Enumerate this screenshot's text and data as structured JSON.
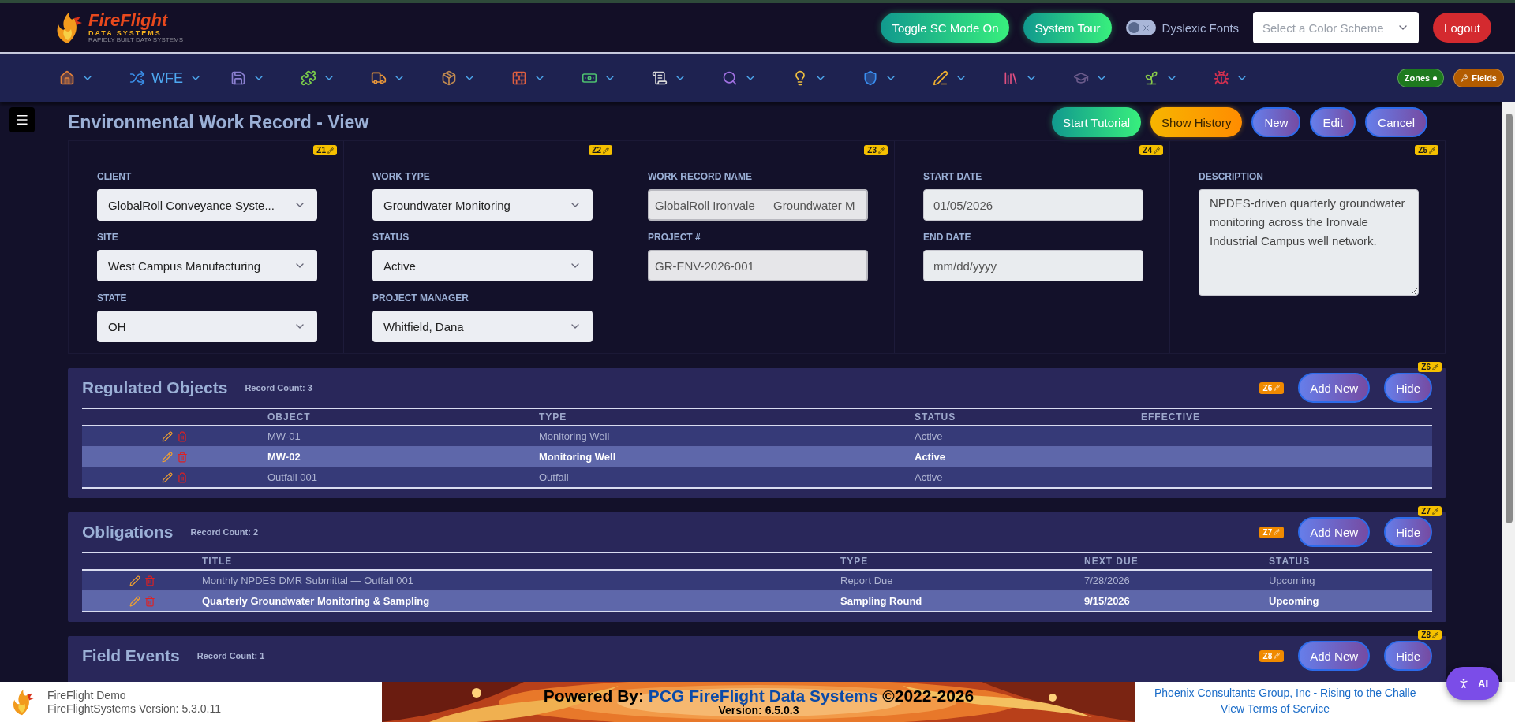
{
  "header": {
    "logo": {
      "name": "FireFlight",
      "tagline": "DATA SYSTEMS",
      "subtitle": "RAPIDLY BUILT DATA SYSTEMS"
    },
    "buttons": [
      {
        "label": "Toggle SC Mode On",
        "kind": "green"
      },
      {
        "label": "System Tour",
        "kind": "green"
      }
    ],
    "dyslexic": {
      "label": "Dyslexic Fonts",
      "on": false
    },
    "color_scheme": {
      "placeholder": "Select a Color Scheme"
    },
    "logout": "Logout"
  },
  "nav": {
    "wfe_label": "WFE",
    "badges": [
      {
        "label": "Zones",
        "kind": "zones",
        "color": "#1e7a1e"
      },
      {
        "label": "Fields",
        "kind": "fields",
        "color": "#b35c00"
      }
    ]
  },
  "page": {
    "title": "Environmental Work Record - View",
    "actions": [
      {
        "label": "Start Tutorial",
        "kind": "green"
      },
      {
        "label": "Show History",
        "kind": "orange"
      },
      {
        "label": "New",
        "kind": "purple"
      },
      {
        "label": "Edit",
        "kind": "purple"
      },
      {
        "label": "Cancel",
        "kind": "purple"
      }
    ]
  },
  "form": {
    "zones": [
      {
        "badge": "Z1",
        "fields": [
          {
            "label": "CLIENT",
            "kind": "select",
            "value": "GlobalRoll Conveyance Syste..."
          },
          {
            "label": "SITE",
            "kind": "select",
            "value": "West Campus Manufacturing"
          },
          {
            "label": "STATE",
            "kind": "select",
            "value": "OH"
          }
        ]
      },
      {
        "badge": "Z2",
        "fields": [
          {
            "label": "WORK TYPE",
            "kind": "select",
            "value": "Groundwater Monitoring"
          },
          {
            "label": "STATUS",
            "kind": "select",
            "value": "Active"
          },
          {
            "label": "PROJECT MANAGER",
            "kind": "select",
            "value": "Whitfield, Dana"
          }
        ]
      },
      {
        "badge": "Z3",
        "fields": [
          {
            "label": "WORK RECORD NAME",
            "kind": "readonly",
            "value": "GlobalRoll Ironvale — Groundwater M"
          },
          {
            "label": "PROJECT #",
            "kind": "readonly",
            "value": "GR-ENV-2026-001"
          }
        ]
      },
      {
        "badge": "Z4",
        "fields": [
          {
            "label": "START DATE",
            "kind": "date",
            "value": "01/05/2026"
          },
          {
            "label": "END DATE",
            "kind": "date",
            "placeholder": "mm/dd/yyyy"
          }
        ]
      },
      {
        "badge": "Z5",
        "fields": [
          {
            "label": "DESCRIPTION",
            "kind": "textarea",
            "value": "NPDES-driven quarterly groundwater monitoring across the Ironvale Industrial Campus well network."
          }
        ]
      }
    ]
  },
  "sections": [
    {
      "kind": "objects",
      "title": "Regulated Objects",
      "count": "Record Count: 3",
      "zone_badge": "Z6",
      "corner_badge": "Z6",
      "buttons": [
        "Add New",
        "Hide"
      ],
      "columns": [
        "OBJECT",
        "TYPE",
        "STATUS",
        "EFFECTIVE"
      ],
      "rows": [
        {
          "cells": [
            "MW-01",
            "Monitoring Well",
            "Active"
          ],
          "selected": false
        },
        {
          "cells": [
            "MW-02",
            "Monitoring Well",
            "Active"
          ],
          "selected": true
        },
        {
          "cells": [
            "Outfall 001",
            "Outfall",
            "Active"
          ],
          "selected": false
        }
      ]
    },
    {
      "kind": "obligations",
      "title": "Obligations",
      "count": "Record Count: 2",
      "zone_badge": "Z7",
      "corner_badge": "Z7",
      "buttons": [
        "Add New",
        "Hide"
      ],
      "columns": [
        "TITLE",
        "TYPE",
        "NEXT DUE",
        "STATUS"
      ],
      "rows": [
        {
          "cells": [
            "Monthly NPDES DMR Submittal — Outfall 001",
            "Report Due",
            "7/28/2026",
            "Upcoming"
          ],
          "selected": false
        },
        {
          "cells": [
            "Quarterly Groundwater Monitoring & Sampling",
            "Sampling Round",
            "9/15/2026",
            "Upcoming"
          ],
          "selected": true
        }
      ]
    },
    {
      "kind": "events",
      "title": "Field Events",
      "count": "Record Count: 1",
      "zone_badge": "Z8",
      "corner_badge": "Z8",
      "buttons": [
        "Add New",
        "Hide"
      ]
    }
  ],
  "footer": {
    "app_name": "FireFlight Demo",
    "app_version": "FireFlightSystems Version: 5.3.0.11",
    "powered_prefix": "Powered By:",
    "brand": "PCG FireFlight Data Systems",
    "copyright": "©2022-2026",
    "version": "Version: 6.5.0.3",
    "company_link": "Phoenix Consultants Group, Inc - Rising to the Challe",
    "terms_link": "View Terms of Service"
  },
  "ai_button": "AI"
}
